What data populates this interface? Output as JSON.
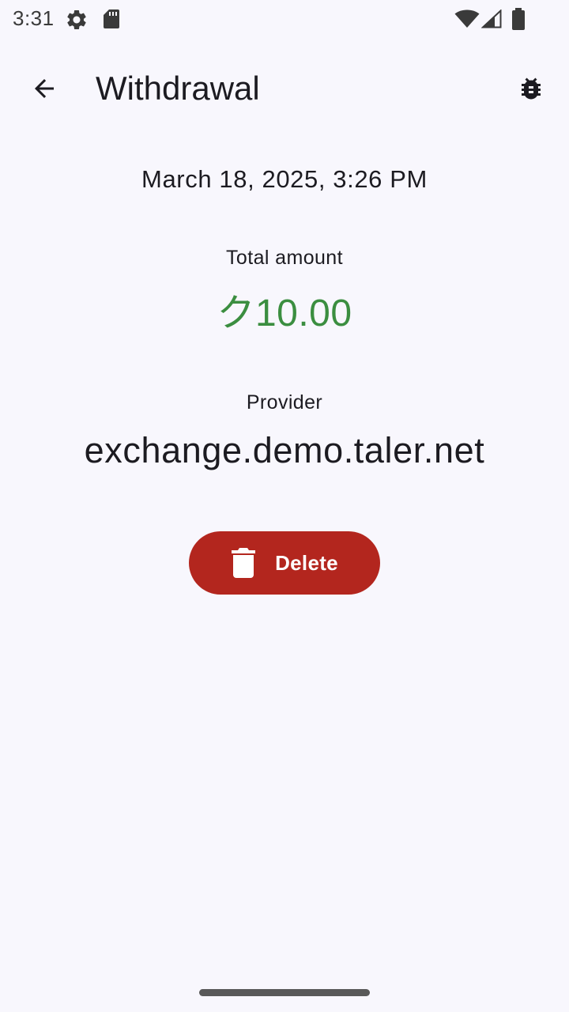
{
  "status_bar": {
    "time": "3:31",
    "icons": [
      "settings-gear-icon",
      "sd-card-icon",
      "wifi-icon",
      "cell-signal-icon",
      "battery-icon"
    ]
  },
  "app_bar": {
    "title": "Withdrawal",
    "back_icon": "arrow-back-icon",
    "action_icon": "bug-icon"
  },
  "transaction": {
    "timestamp": "March 18, 2025, 3:26 PM",
    "amount_label": "Total amount",
    "amount_value": "ク10.00",
    "provider_label": "Provider",
    "provider_value": "exchange.demo.taler.net"
  },
  "actions": {
    "delete_label": "Delete",
    "delete_icon": "trash-icon"
  },
  "colors": {
    "background": "#f8f7fd",
    "amount_positive": "#3b8e40",
    "delete_button": "#b3261e",
    "text_primary": "#1c1b21"
  }
}
